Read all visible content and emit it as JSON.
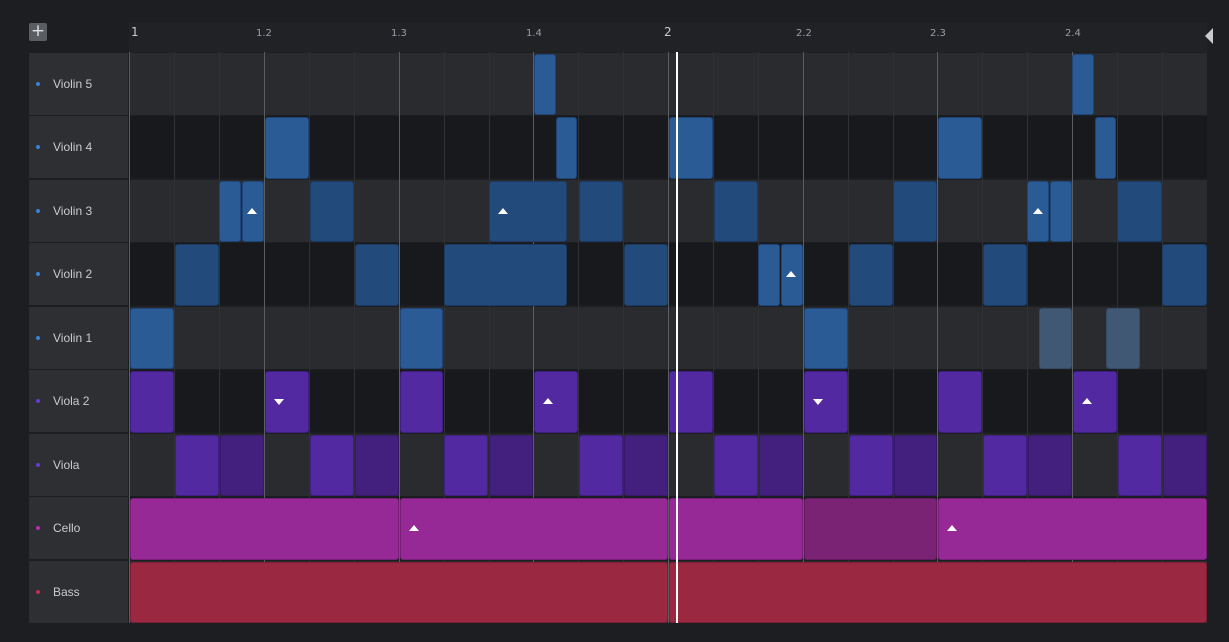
{
  "toolbar": {
    "add_label": "+"
  },
  "ruler": {
    "ticks": [
      {
        "label": "1",
        "major": true
      },
      {
        "label": "1.2",
        "major": false
      },
      {
        "label": "1.3",
        "major": false
      },
      {
        "label": "1.4",
        "major": false
      },
      {
        "label": "2",
        "major": true
      },
      {
        "label": "2.2",
        "major": false
      },
      {
        "label": "2.3",
        "major": false
      },
      {
        "label": "2.4",
        "major": false
      }
    ]
  },
  "tracks": [
    {
      "name": "Violin 5",
      "color": "#3d7fd0"
    },
    {
      "name": "Violin 4",
      "color": "#3d7fd0"
    },
    {
      "name": "Violin 3",
      "color": "#3d7fd0"
    },
    {
      "name": "Violin 2",
      "color": "#3d7fd0"
    },
    {
      "name": "Violin 1",
      "color": "#3d7fd0"
    },
    {
      "name": "Viola 2",
      "color": "#6a3bd0"
    },
    {
      "name": "Viola",
      "color": "#6a3bd0"
    },
    {
      "name": "Cello",
      "color": "#b030b0"
    },
    {
      "name": "Bass",
      "color": "#c0304a"
    }
  ],
  "colors": {
    "violin": "#2a5b95",
    "viola": "#5229a0",
    "cello": "#972996",
    "bass": "#9a2840",
    "playhead": "#ffffff"
  }
}
